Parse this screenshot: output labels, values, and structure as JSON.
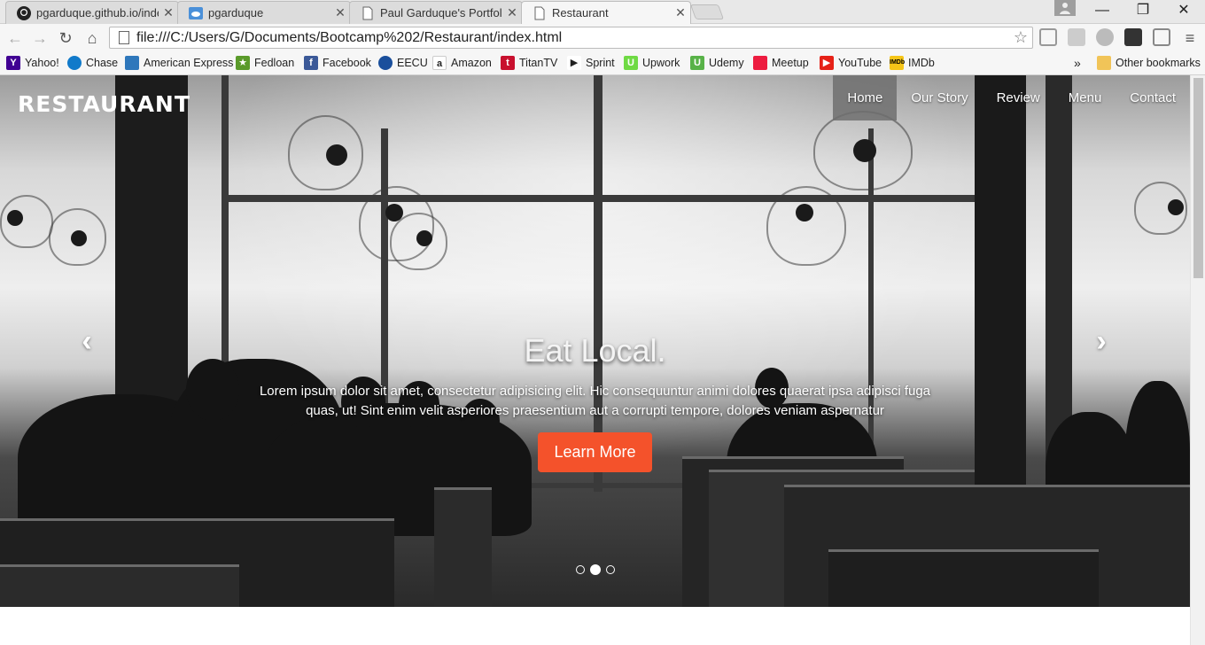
{
  "browser": {
    "tabs": [
      {
        "title": "pgarduque.github.io/inde",
        "icon": "github-icon"
      },
      {
        "title": "pgarduque",
        "icon": "cloud-icon"
      },
      {
        "title": "Paul Garduque's Portfolio",
        "icon": "page-icon"
      },
      {
        "title": "Restaurant",
        "icon": "page-icon"
      }
    ],
    "active_tab": 3,
    "url": "file:///C:/Users/G/Documents/Bootcamp%202/Restaurant/index.html",
    "bookmarks": [
      {
        "label": "Yahoo!",
        "icon": "yahoo-icon",
        "color": "#410093"
      },
      {
        "label": "Chase",
        "icon": "chase-icon",
        "color": "#117aca"
      },
      {
        "label": "American Express",
        "icon": "amex-icon",
        "color": "#2e77bb"
      },
      {
        "label": "Fedloan",
        "icon": "fedloan-icon",
        "color": "#5a9a2a"
      },
      {
        "label": "Facebook",
        "icon": "facebook-icon",
        "color": "#3b5998"
      },
      {
        "label": "EECU",
        "icon": "eecu-icon",
        "color": "#1a4f9c"
      },
      {
        "label": "Amazon",
        "icon": "amazon-icon",
        "color": "#ffffff"
      },
      {
        "label": "TitanTV",
        "icon": "titantv-icon",
        "color": "#c8102e"
      },
      {
        "label": "Sprint",
        "icon": "sprint-icon",
        "color": "#ffffff"
      },
      {
        "label": "Upwork",
        "icon": "upwork-icon",
        "color": "#6fda44"
      },
      {
        "label": "Udemy",
        "icon": "udemy-icon",
        "color": "#58b248"
      },
      {
        "label": "Meetup",
        "icon": "meetup-icon",
        "color": "#ed1c40"
      },
      {
        "label": "YouTube",
        "icon": "youtube-icon",
        "color": "#e62117"
      },
      {
        "label": "IMDb",
        "icon": "imdb-icon",
        "color": "#f5c518"
      }
    ],
    "more_glyph": "»",
    "other_bookmarks": "Other bookmarks"
  },
  "site": {
    "brand": "RESTAURANT",
    "nav": [
      "Home",
      "Our Story",
      "Review",
      "Menu",
      "Contact"
    ],
    "active_nav": 0,
    "hero": {
      "title": "Eat Local.",
      "text": "Lorem ipsum dolor sit amet, consectetur adipisicing elit. Hic consequuntur animi dolores quaerat ipsa adipisci fuga quas, ut! Sint enim velit asperiores praesentium aut a corrupti tempore, dolores veniam aspernatur",
      "button": "Learn More",
      "accent": "#f4522b",
      "slides": 3,
      "active_slide": 1
    }
  }
}
